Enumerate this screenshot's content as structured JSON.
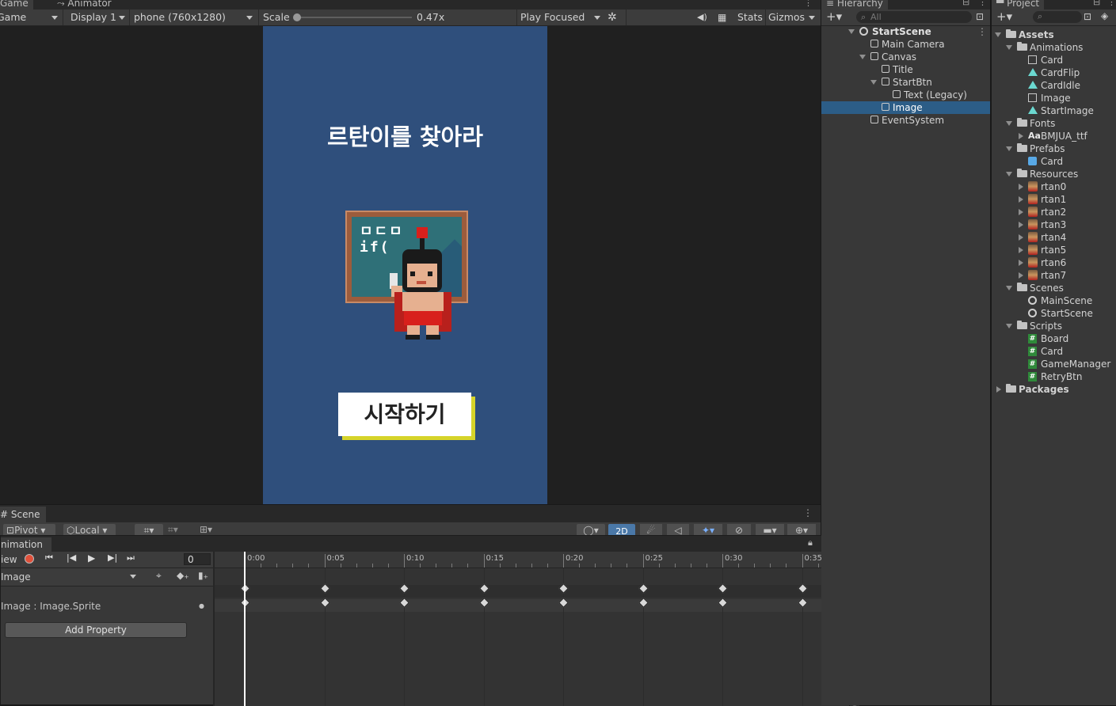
{
  "game_panel": {
    "tabs": [
      "Game",
      "Animator"
    ],
    "toolbar": {
      "view_mode": "Game",
      "display": "Display 1",
      "resolution": "phone (760x1280)",
      "scale_label": "Scale",
      "scale_value": "0.47x",
      "play_mode": "Play Focused",
      "stats": "Stats",
      "gizmos": "Gizmos"
    },
    "game_view": {
      "title": "르탄이를 찾아라",
      "start_button": "시작하기",
      "board_text_line1": "ㅁㄷㅁ",
      "board_text_line2": "if(",
      "bg_color": "#2f4f7c",
      "button_shadow_color": "#d6d42a"
    }
  },
  "hierarchy": {
    "tab": "Hierarchy",
    "search_placeholder": "All",
    "scene": "StartScene",
    "items": [
      {
        "label": "Main Camera",
        "depth": 1,
        "arrow": "none",
        "selected": false
      },
      {
        "label": "Canvas",
        "depth": 1,
        "arrow": "down",
        "selected": false
      },
      {
        "label": "Title",
        "depth": 2,
        "arrow": "none",
        "selected": false
      },
      {
        "label": "StartBtn",
        "depth": 2,
        "arrow": "down",
        "selected": false
      },
      {
        "label": "Text (Legacy)",
        "depth": 3,
        "arrow": "none",
        "selected": false
      },
      {
        "label": "Image",
        "depth": 2,
        "arrow": "none",
        "selected": true
      },
      {
        "label": "EventSystem",
        "depth": 1,
        "arrow": "none",
        "selected": false
      }
    ]
  },
  "project": {
    "tab": "Project",
    "items": [
      {
        "label": "Assets",
        "depth": 0,
        "icon": "folder",
        "arrow": "down",
        "bold": true
      },
      {
        "label": "Animations",
        "depth": 1,
        "icon": "folder",
        "arrow": "down"
      },
      {
        "label": "Card",
        "depth": 2,
        "icon": "controller",
        "arrow": "none"
      },
      {
        "label": "CardFlip",
        "depth": 2,
        "icon": "clip",
        "arrow": "none"
      },
      {
        "label": "CardIdle",
        "depth": 2,
        "icon": "clip",
        "arrow": "none"
      },
      {
        "label": "Image",
        "depth": 2,
        "icon": "controller",
        "arrow": "none"
      },
      {
        "label": "StartImage",
        "depth": 2,
        "icon": "clip",
        "arrow": "none"
      },
      {
        "label": "Fonts",
        "depth": 1,
        "icon": "folder",
        "arrow": "down"
      },
      {
        "label": "BMJUA_ttf",
        "depth": 2,
        "icon": "font",
        "arrow": "right"
      },
      {
        "label": "Prefabs",
        "depth": 1,
        "icon": "folder",
        "arrow": "down"
      },
      {
        "label": "Card",
        "depth": 2,
        "icon": "prefab",
        "arrow": "none"
      },
      {
        "label": "Resources",
        "depth": 1,
        "icon": "folder",
        "arrow": "down"
      },
      {
        "label": "rtan0",
        "depth": 2,
        "icon": "sprite",
        "arrow": "right"
      },
      {
        "label": "rtan1",
        "depth": 2,
        "icon": "sprite",
        "arrow": "right"
      },
      {
        "label": "rtan2",
        "depth": 2,
        "icon": "sprite",
        "arrow": "right"
      },
      {
        "label": "rtan3",
        "depth": 2,
        "icon": "sprite",
        "arrow": "right"
      },
      {
        "label": "rtan4",
        "depth": 2,
        "icon": "sprite",
        "arrow": "right"
      },
      {
        "label": "rtan5",
        "depth": 2,
        "icon": "sprite",
        "arrow": "right"
      },
      {
        "label": "rtan6",
        "depth": 2,
        "icon": "sprite",
        "arrow": "right"
      },
      {
        "label": "rtan7",
        "depth": 2,
        "icon": "sprite",
        "arrow": "right"
      },
      {
        "label": "Scenes",
        "depth": 1,
        "icon": "folder",
        "arrow": "down"
      },
      {
        "label": "MainScene",
        "depth": 2,
        "icon": "unity",
        "arrow": "none"
      },
      {
        "label": "StartScene",
        "depth": 2,
        "icon": "unity",
        "arrow": "none"
      },
      {
        "label": "Scripts",
        "depth": 1,
        "icon": "folder",
        "arrow": "down"
      },
      {
        "label": "Board",
        "depth": 2,
        "icon": "script",
        "arrow": "none"
      },
      {
        "label": "Card",
        "depth": 2,
        "icon": "script",
        "arrow": "none"
      },
      {
        "label": "GameManager",
        "depth": 2,
        "icon": "script",
        "arrow": "none"
      },
      {
        "label": "RetryBtn",
        "depth": 2,
        "icon": "script",
        "arrow": "none"
      },
      {
        "label": "Packages",
        "depth": 0,
        "icon": "folder",
        "arrow": "right",
        "bold": true
      }
    ]
  },
  "scene_panel": {
    "tab": "Scene",
    "pivot": "Pivot",
    "local": "Local",
    "mode_2d": "2D"
  },
  "animation_panel": {
    "tab": "nimation",
    "preview": "iew",
    "frame": "0",
    "clip": "Image",
    "property": "Image : Image.Sprite",
    "add_property": "Add Property",
    "time_labels": [
      "0:00",
      "0:05",
      "0:10",
      "0:15",
      "0:20",
      "0:25",
      "0:30",
      "0:35"
    ],
    "keyframe_times": [
      0,
      5,
      10,
      15,
      20,
      25,
      30,
      35
    ]
  }
}
